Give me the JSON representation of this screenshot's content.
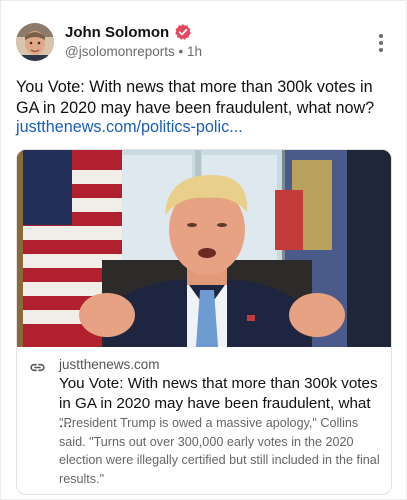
{
  "post": {
    "author_name": "John Solomon",
    "handle": "@jsolomonreports",
    "separator": "•",
    "time_ago": "1h",
    "text": "You Vote: With news that more than 300k votes in GA in 2020 may have been fraudulent, what now?",
    "link_text": "justthenews.com/politics-polic..."
  },
  "link_card": {
    "domain": "justthenews.com",
    "title": "You Vote: With news that more than 300k votes in GA in 2020 may have been fraudulent, what ...",
    "description": "\"President Trump is owed a massive apology,\" Collins said. \"Turns out over 300,000 early votes in the 2020 election were illegally certified but still included in the final results.\""
  },
  "icons": {
    "verified": "verified-badge-icon",
    "more": "more-options-icon",
    "link": "link-icon"
  },
  "colors": {
    "link": "#1a5fb4",
    "verified_badge": "#e8455a",
    "secondary_text": "#6b6b6b"
  }
}
